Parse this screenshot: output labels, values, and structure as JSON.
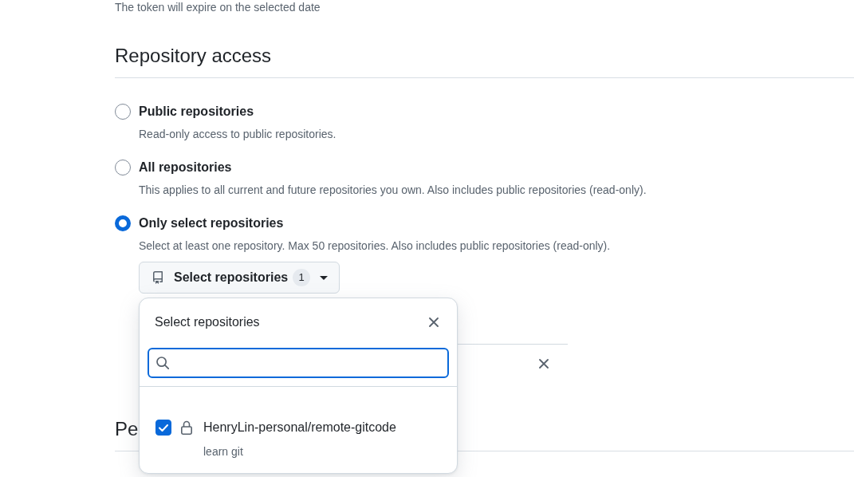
{
  "hint": "The token will expire on the selected date",
  "section": {
    "title": "Repository access"
  },
  "options": [
    {
      "label": "Public repositories",
      "description": "Read-only access to public repositories.",
      "selected": false
    },
    {
      "label": "All repositories",
      "description": "This applies to all current and future repositories you own. Also includes public repositories (read-only).",
      "selected": false
    },
    {
      "label": "Only select repositories",
      "description": "Select at least one repository. Max 50 repositories. Also includes public repositories (read-only).",
      "selected": true
    }
  ],
  "select_button": {
    "label": "Select repositories",
    "count": "1"
  },
  "popup": {
    "title": "Select repositories",
    "search": {
      "focused": true
    },
    "items": [
      {
        "name": "HenryLin-personal/remote-gitcode",
        "description": "learn git",
        "checked": true,
        "private": true
      }
    ]
  },
  "next_section": {
    "title": "Pe"
  }
}
